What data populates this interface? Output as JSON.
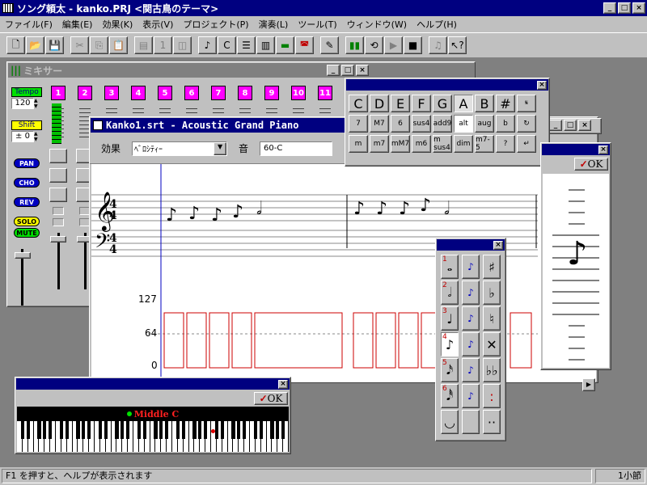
{
  "app": {
    "title": "ソング頼太 - kanko.PRJ <関古鳥のテーマ>",
    "title_icon": "keyboard-icon"
  },
  "menu": [
    "ファイル(F)",
    "編集(E)",
    "効果(K)",
    "表示(V)",
    "プロジェクト(P)",
    "演奏(L)",
    "ツール(T)",
    "ウィンドウ(W)",
    "ヘルプ(H)"
  ],
  "mixer": {
    "title": "ミキサー",
    "tempo_label": "Tempo",
    "tempo_value": "120",
    "shift_label": "Shift",
    "shift_value": "± 0",
    "channels": [
      "1",
      "2",
      "3",
      "4",
      "5",
      "6",
      "7",
      "8",
      "9",
      "10",
      "11"
    ],
    "buttons": {
      "pan": "PAN",
      "cho": "CHO",
      "rev": "REV",
      "solo": "SOLO",
      "mute": "MUTE"
    }
  },
  "editor": {
    "title": "Kanko1.srt - Acoustic Grand Piano",
    "effect_label": "効果",
    "effect_value": "ﾍﾞﾛｼﾃｨｰ",
    "sound_label": "音",
    "sound_value": "60-C",
    "axis": {
      "top": "127",
      "mid": "64",
      "bottom": "0"
    }
  },
  "chord_palette": {
    "row1": [
      "C",
      "D",
      "E",
      "F",
      "G",
      "A",
      "B",
      "#"
    ],
    "row2": [
      "7",
      "M7",
      "6",
      "sus4",
      "add9",
      "alt",
      "aug",
      "b"
    ],
    "row3": [
      "m",
      "m7",
      "mM7",
      "m6",
      "m sus4",
      "dim",
      "m7-5",
      "?"
    ],
    "selected": "A"
  },
  "note_panel": {
    "ok_label": "OK"
  },
  "keyboard": {
    "ok_label": "OK",
    "middle_c_label": "Middle C"
  },
  "note_palette": {
    "durations": [
      "1",
      "2",
      "3",
      "4",
      "5",
      "6"
    ],
    "selected": "4"
  },
  "statusbar": {
    "help_text": "F1 を押すと、ヘルプが表示されます",
    "measure_text": "1小節"
  },
  "colors": {
    "title_active": "#000080",
    "magenta": "#ff00ff",
    "velocity_red": "#cc0000",
    "desktop": "#808080"
  }
}
